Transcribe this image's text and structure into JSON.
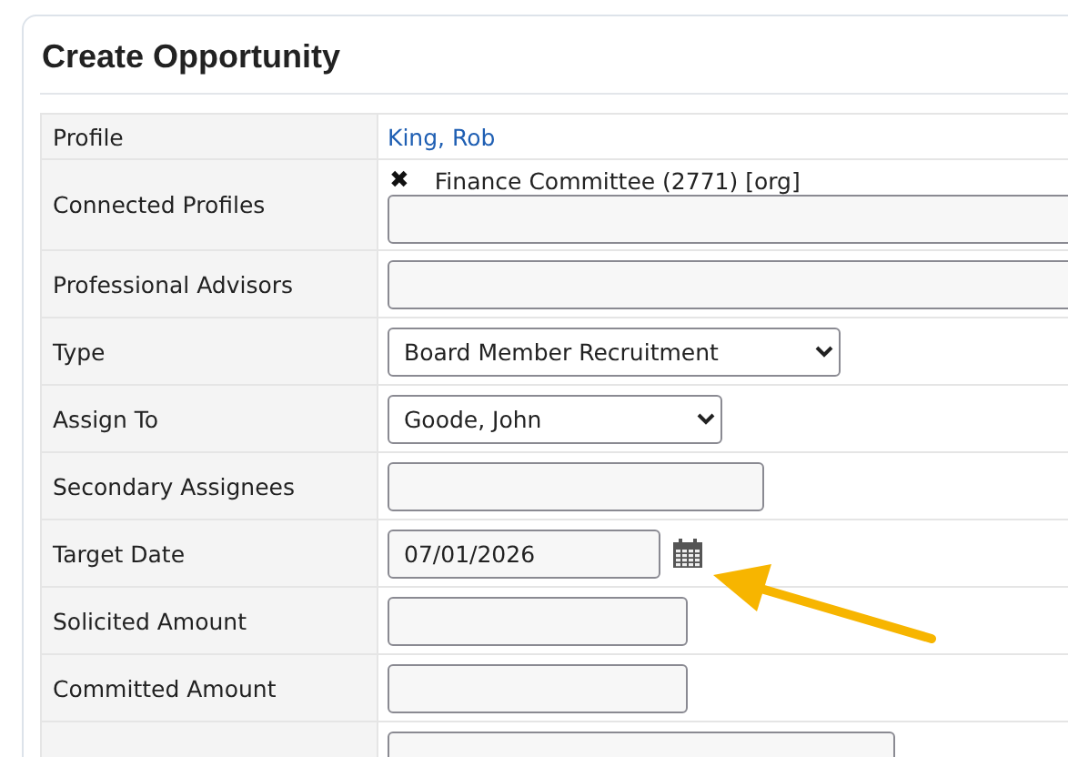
{
  "form": {
    "title": "Create Opportunity",
    "rows": [
      {
        "label": "Profile",
        "kind": "link",
        "value": "King, Rob"
      },
      {
        "label": "Connected Profiles",
        "kind": "connections",
        "items": [
          {
            "remove": "✖",
            "text": "Finance Committee (2771) [org]"
          }
        ]
      },
      {
        "label": "Professional Advisors",
        "kind": "text"
      },
      {
        "label": "Type",
        "kind": "select",
        "value": "Board Member Recruitment"
      },
      {
        "label": "Assign To",
        "kind": "select",
        "value": "Goode, John"
      },
      {
        "label": "Secondary Assignees",
        "kind": "text"
      },
      {
        "label": "Target Date",
        "kind": "date",
        "value": "07/01/2026"
      },
      {
        "label": "Solicited Amount",
        "kind": "text"
      },
      {
        "label": "Committed Amount",
        "kind": "text"
      },
      {
        "kind": "text"
      }
    ]
  }
}
